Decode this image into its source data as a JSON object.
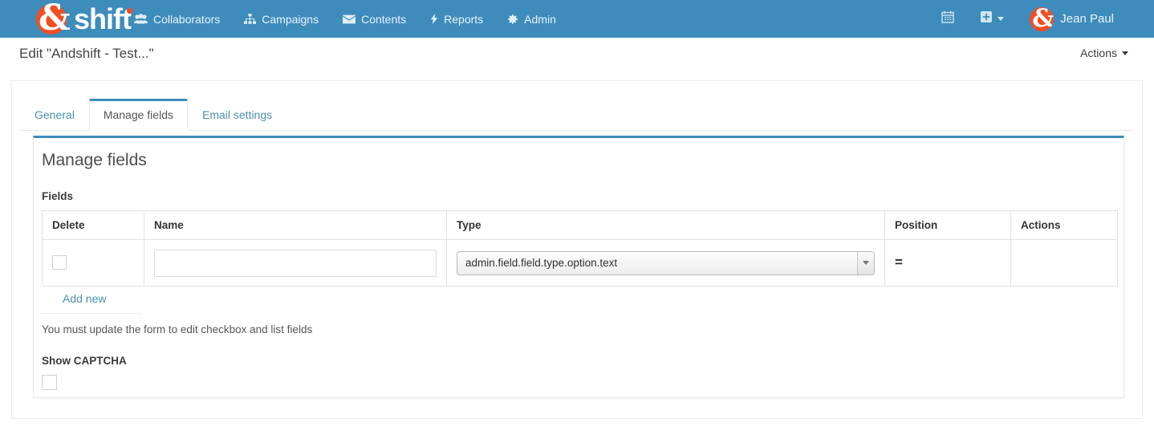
{
  "navbar": {
    "brand": {
      "amp": "&",
      "text": "shift"
    },
    "items": [
      {
        "label": "Collaborators",
        "icon": "users-icon"
      },
      {
        "label": "Campaigns",
        "icon": "sitemap-icon"
      },
      {
        "label": "Contents",
        "icon": "envelope-icon"
      },
      {
        "label": "Reports",
        "icon": "bolt-icon"
      },
      {
        "label": "Admin",
        "icon": "gear-icon"
      }
    ],
    "right": {
      "calendar_icon": "calendar-icon",
      "add_icon": "plus-square-icon",
      "user_name": "Jean Paul",
      "avatar_glyph": "&"
    },
    "background": "#3e8cbc",
    "brand_color": "#f04e23"
  },
  "page": {
    "title": "Edit \"Andshift - Test...\"",
    "actions_label": "Actions"
  },
  "tabs": [
    {
      "label": "General",
      "active": false
    },
    {
      "label": "Manage fields",
      "active": true
    },
    {
      "label": "Email settings",
      "active": false
    }
  ],
  "panel": {
    "title": "Manage fields",
    "fields_label": "Fields",
    "table": {
      "headers": [
        "Delete",
        "Name",
        "Type",
        "Position",
        "Actions"
      ],
      "rows": [
        {
          "delete_checked": false,
          "name_value": "",
          "name_placeholder": "",
          "type_value": "admin.field.field.type.option.text",
          "position_handle": "=",
          "actions": ""
        }
      ]
    },
    "add_new_label": "Add new",
    "hint": "You must update the form to edit checkbox and list fields",
    "captcha_label": "Show CAPTCHA",
    "captcha_checked": false
  },
  "colors": {
    "accent": "#3e8cbc",
    "link": "#4a90ab",
    "brand_orange": "#f04e23"
  }
}
